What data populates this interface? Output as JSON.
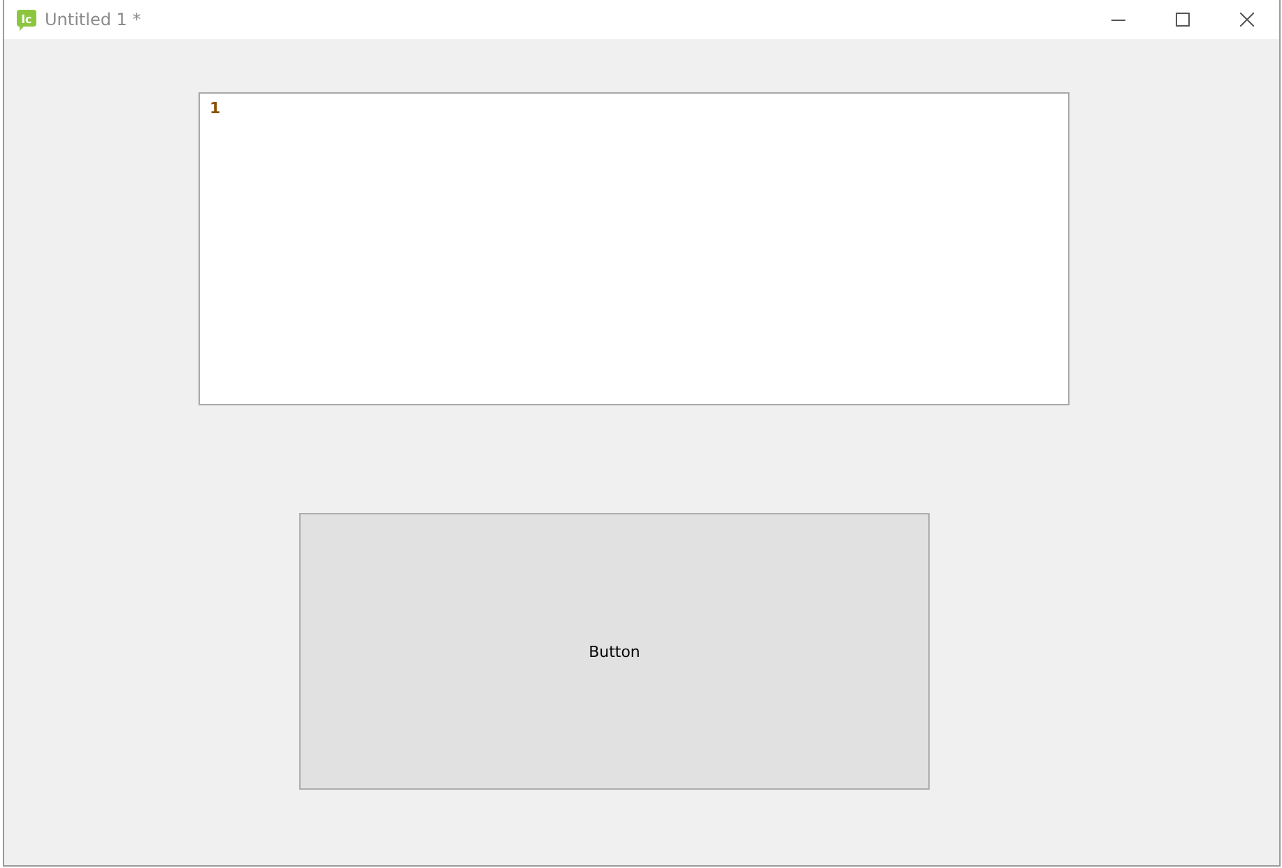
{
  "window": {
    "title": "Untitled 1 *",
    "logo": "lc"
  },
  "editor": {
    "line_numbers": [
      "1"
    ]
  },
  "button": {
    "label": "Button"
  }
}
